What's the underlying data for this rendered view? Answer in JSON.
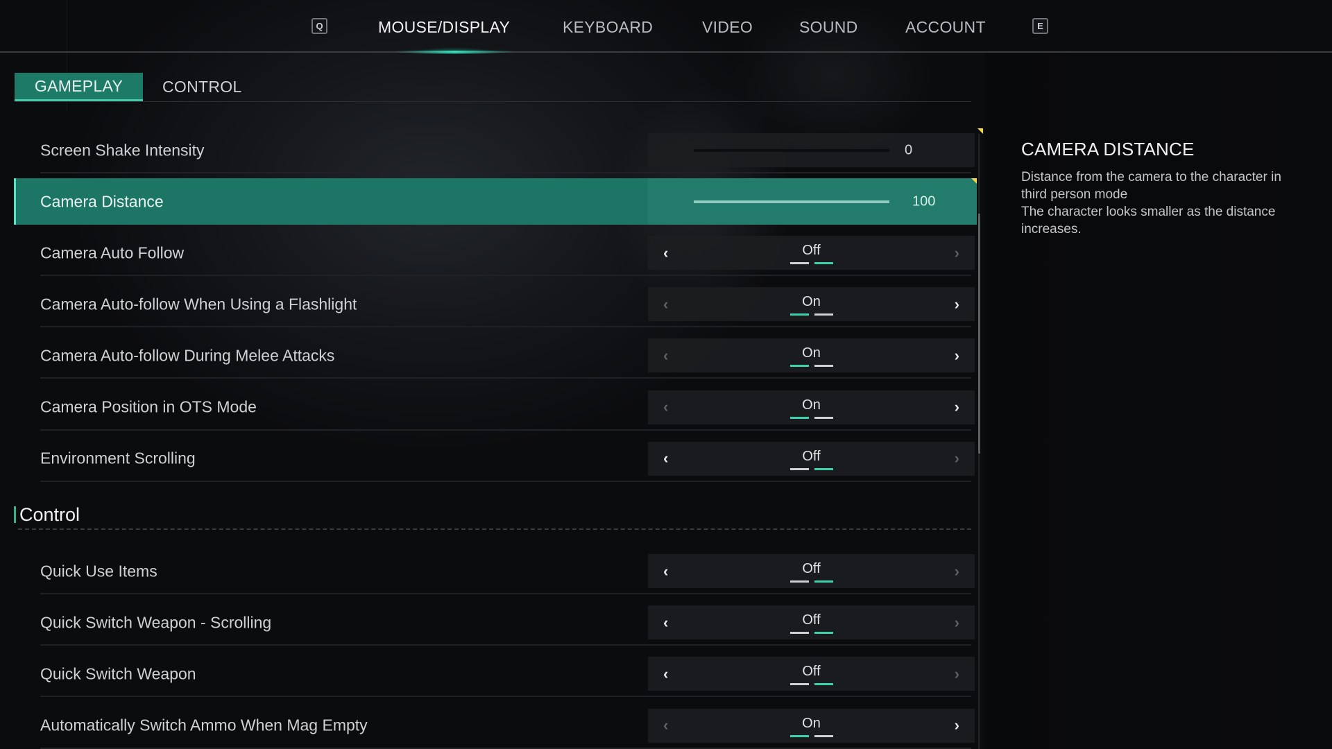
{
  "top_nav": {
    "prev_key": "Q",
    "next_key": "E",
    "tabs": [
      {
        "label": "MOUSE/DISPLAY",
        "active": true
      },
      {
        "label": "KEYBOARD",
        "active": false
      },
      {
        "label": "VIDEO",
        "active": false
      },
      {
        "label": "SOUND",
        "active": false
      },
      {
        "label": "ACCOUNT",
        "active": false
      }
    ]
  },
  "sub_tabs": [
    {
      "label": "GAMEPLAY",
      "active": true
    },
    {
      "label": "CONTROL",
      "active": false
    }
  ],
  "settings": {
    "sliders": [
      {
        "label": "Screen Shake Intensity",
        "value": "0",
        "fraction": 0.0,
        "selected": false
      },
      {
        "label": "Camera Distance",
        "value": "100",
        "fraction": 1.0,
        "selected": true
      }
    ],
    "gameplay_options": [
      {
        "label": "Camera Auto Follow",
        "value": "Off"
      },
      {
        "label": "Camera Auto-follow When Using a Flashlight",
        "value": "On"
      },
      {
        "label": "Camera Auto-follow During Melee Attacks",
        "value": "On"
      },
      {
        "label": "Camera Position in OTS Mode",
        "value": "On"
      },
      {
        "label": "Environment Scrolling",
        "value": "Off"
      }
    ],
    "control_section_title": "Control",
    "control_options": [
      {
        "label": "Quick Use Items",
        "value": "Off"
      },
      {
        "label": "Quick Switch Weapon - Scrolling",
        "value": "Off"
      },
      {
        "label": "Quick Switch Weapon",
        "value": "Off"
      },
      {
        "label": "Automatically Switch Ammo When Mag Empty",
        "value": "On"
      }
    ]
  },
  "description": {
    "title": "CAMERA DISTANCE",
    "lines": [
      "Distance from the camera to the character in",
      "third person mode",
      "The character looks smaller as the distance",
      "increases."
    ]
  },
  "scrollbar": {
    "position_fraction": 0.13,
    "visible_fraction": 0.39
  },
  "colors": {
    "accent_teal": "#1d7565",
    "indicator_teal": "#3ad3ab",
    "marker_yellow": "#f0d640"
  },
  "icons": {
    "left_arrow": "‹",
    "right_arrow": "›"
  }
}
